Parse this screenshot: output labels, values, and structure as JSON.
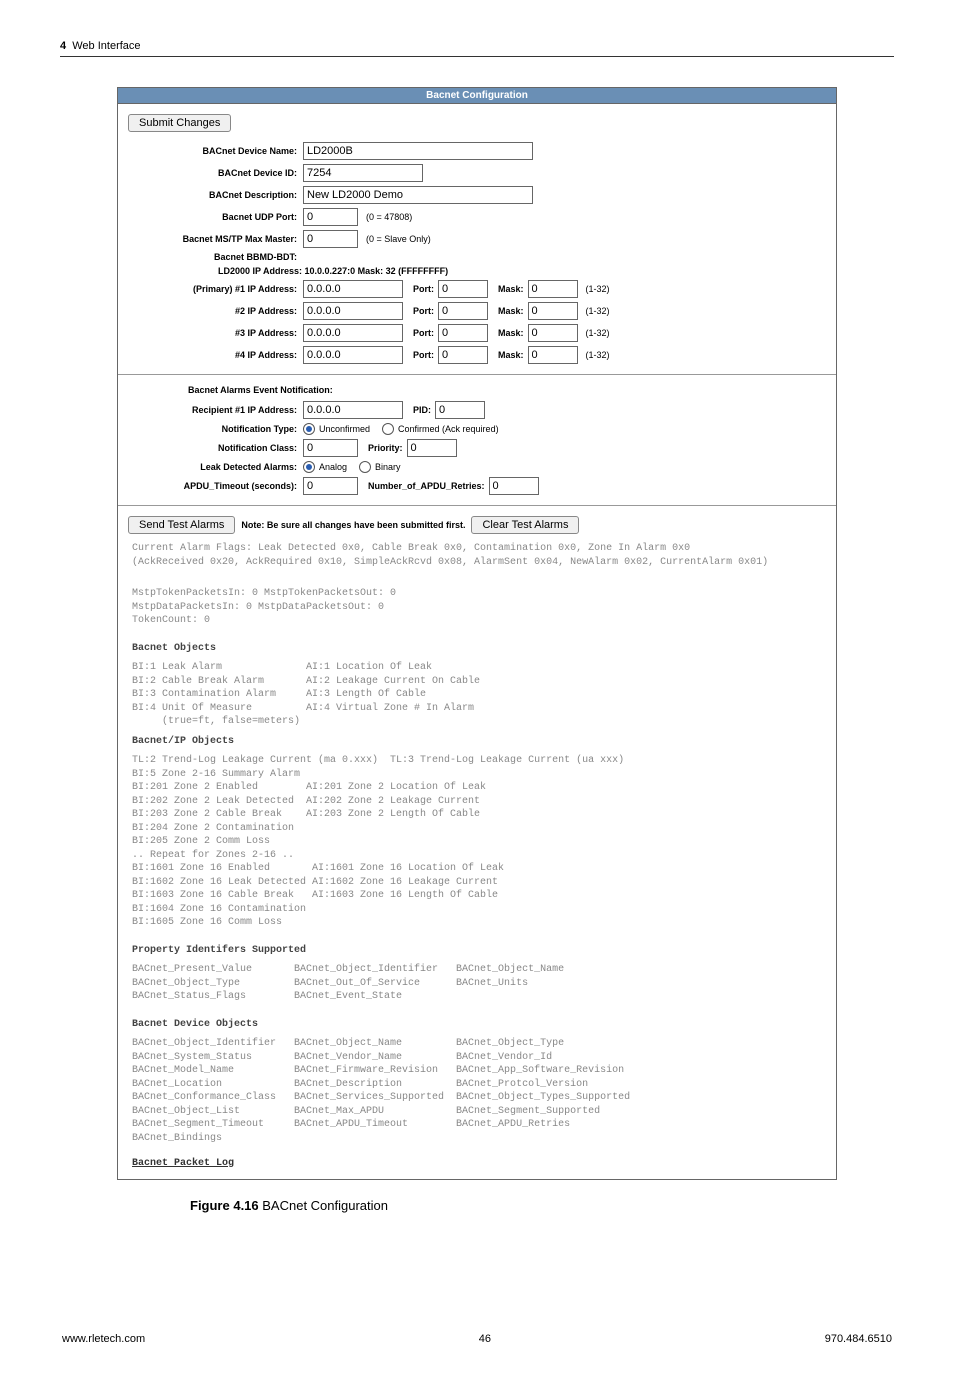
{
  "header": {
    "section_num": "4",
    "section_title": "Web Interface"
  },
  "panel": {
    "title": "Bacnet Configuration",
    "submit_btn": "Submit Changes",
    "labels": {
      "device_name": "BACnet Device Name:",
      "device_id": "BACnet Device ID:",
      "description": "BACnet Description:",
      "udp_port": "Bacnet UDP Port:",
      "mstp_master": "Bacnet MS/TP Max Master:",
      "bbmd_bdt": "Bacnet BBMD-BDT:",
      "bbmd_line": "LD2000 IP Address: 10.0.0.227:0 Mask: 32 (FFFFFFFF)",
      "ip1": "(Primary) #1 IP Address:",
      "ip2": "#2 IP Address:",
      "ip3": "#3 IP Address:",
      "ip4": "#4 IP Address:",
      "port": "Port:",
      "mask": "Mask:",
      "mask_hint": "(1-32)",
      "udp_hint": "(0 = 47808)",
      "mstp_hint": "(0 = Slave Only)",
      "alarms_header": "Bacnet Alarms Event Notification:",
      "recipient": "Recipient #1 IP Address:",
      "pid": "PID:",
      "notif_type": "Notification Type:",
      "unconfirmed": "Unconfirmed",
      "confirmed": "Confirmed (Ack required)",
      "notif_class": "Notification Class:",
      "priority": "Priority:",
      "leak_alarms": "Leak Detected Alarms:",
      "analog": "Analog",
      "binary": "Binary",
      "apdu_timeout": "APDU_Timeout (seconds):",
      "apdu_retries": "Number_of_APDU_Retries:"
    },
    "values": {
      "device_name": "LD2000B",
      "device_id": "7254",
      "description": "New LD2000 Demo",
      "udp_port": "0",
      "mstp_master": "0",
      "ip1": "0.0.0.0",
      "port1": "0",
      "mask1": "0",
      "ip2": "0.0.0.0",
      "port2": "0",
      "mask2": "0",
      "ip3": "0.0.0.0",
      "port3": "0",
      "mask3": "0",
      "ip4": "0.0.0.0",
      "port4": "0",
      "mask4": "0",
      "recipient_ip": "0.0.0.0",
      "pid": "0",
      "notif_class": "0",
      "priority": "0",
      "apdu_timeout": "0",
      "apdu_retries": "0"
    },
    "test_row": {
      "send": "Send Test Alarms",
      "note": "Note: Be sure all changes have been submitted first.",
      "clear": "Clear Test Alarms"
    },
    "mono_flags": "Current Alarm Flags: Leak Detected 0x0, Cable Break 0x0, Contamination 0x0, Zone In Alarm 0x0\n(AckReceived 0x20, AckRequired 0x10, SimpleAckRcvd 0x08, AlarmSent 0x04, NewAlarm 0x02, CurrentAlarm 0x01)",
    "mono_counts": "MstpTokenPacketsIn: 0 MstpTokenPacketsOut: 0\nMstpDataPacketsIn: 0 MstpDataPacketsOut: 0\nTokenCount: 0",
    "mono_objects_hd": "Bacnet Objects",
    "mono_objects": "BI:1 Leak Alarm              AI:1 Location Of Leak\nBI:2 Cable Break Alarm       AI:2 Leakage Current On Cable\nBI:3 Contamination Alarm     AI:3 Length Of Cable\nBI:4 Unit Of Measure         AI:4 Virtual Zone # In Alarm\n     (true=ft, false=meters)",
    "mono_ip_hd": "Bacnet/IP Objects",
    "mono_ip": "TL:2 Trend-Log Leakage Current (ma 0.xxx)  TL:3 Trend-Log Leakage Current (ua xxx)\nBI:5 Zone 2-16 Summary Alarm\nBI:201 Zone 2 Enabled        AI:201 Zone 2 Location Of Leak\nBI:202 Zone 2 Leak Detected  AI:202 Zone 2 Leakage Current\nBI:203 Zone 2 Cable Break    AI:203 Zone 2 Length Of Cable\nBI:204 Zone 2 Contamination\nBI:205 Zone 2 Comm Loss\n.. Repeat for Zones 2-16 ..\nBI:1601 Zone 16 Enabled       AI:1601 Zone 16 Location Of Leak\nBI:1602 Zone 16 Leak Detected AI:1602 Zone 16 Leakage Current\nBI:1603 Zone 16 Cable Break   AI:1603 Zone 16 Length Of Cable\nBI:1604 Zone 16 Contamination\nBI:1605 Zone 16 Comm Loss",
    "mono_props_hd": "Property Identifers Supported",
    "mono_props": "BACnet_Present_Value       BACnet_Object_Identifier   BACnet_Object_Name\nBACnet_Object_Type         BACnet_Out_Of_Service      BACnet_Units\nBACnet_Status_Flags        BACnet_Event_State",
    "mono_dev_hd": "Bacnet Device Objects",
    "mono_dev": "BACnet_Object_Identifier   BACnet_Object_Name         BACnet_Object_Type\nBACnet_System_Status       BACnet_Vendor_Name         BACnet_Vendor_Id\nBACnet_Model_Name          BACnet_Firmware_Revision   BACnet_App_Software_Revision\nBACnet_Location            BACnet_Description         BACnet_Protcol_Version\nBACnet_Conformance_Class   BACnet_Services_Supported  BACnet_Object_Types_Supported\nBACnet_Object_List         BACnet_Max_APDU            BACnet_Segment_Supported\nBACnet_Segment_Timeout     BACnet_APDU_Timeout        BACnet_APDU_Retries\nBACnet_Bindings",
    "packet_log": "Bacnet Packet Log"
  },
  "caption": {
    "prefix": "Figure 4.16",
    "text": " BACnet Configuration"
  },
  "footer": {
    "left": "www.rletech.com",
    "center": "46",
    "right": "970.484.6510"
  }
}
